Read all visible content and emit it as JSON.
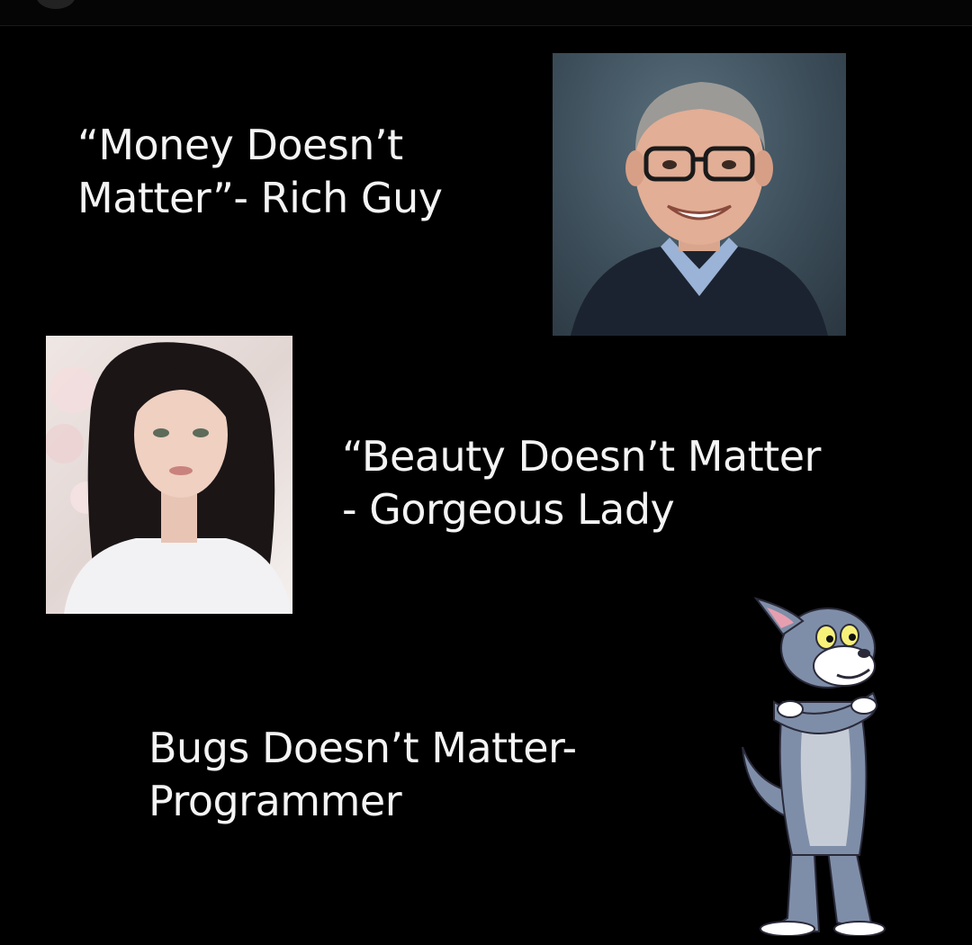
{
  "captions": {
    "money": "“Money Doesn’t\nMatter”- Rich Guy",
    "beauty": "“Beauty Doesn’t Matter\n- Gorgeous Lady",
    "bugs": "Bugs Doesn’t Matter-\nProgrammer"
  },
  "colors": {
    "background": "#000000",
    "text": "#f4f4f4",
    "photo_backdrop_man": "#3d4f5b",
    "tom_fur": "#7f8ea8",
    "tom_belly": "#c6ccd6"
  },
  "images": {
    "man_photo": "smiling-man-with-glasses-photo",
    "woman_photo": "dark-haired-woman-portrait-photo",
    "cartoon": "tom-cat-cartoon-arms-crossed"
  }
}
